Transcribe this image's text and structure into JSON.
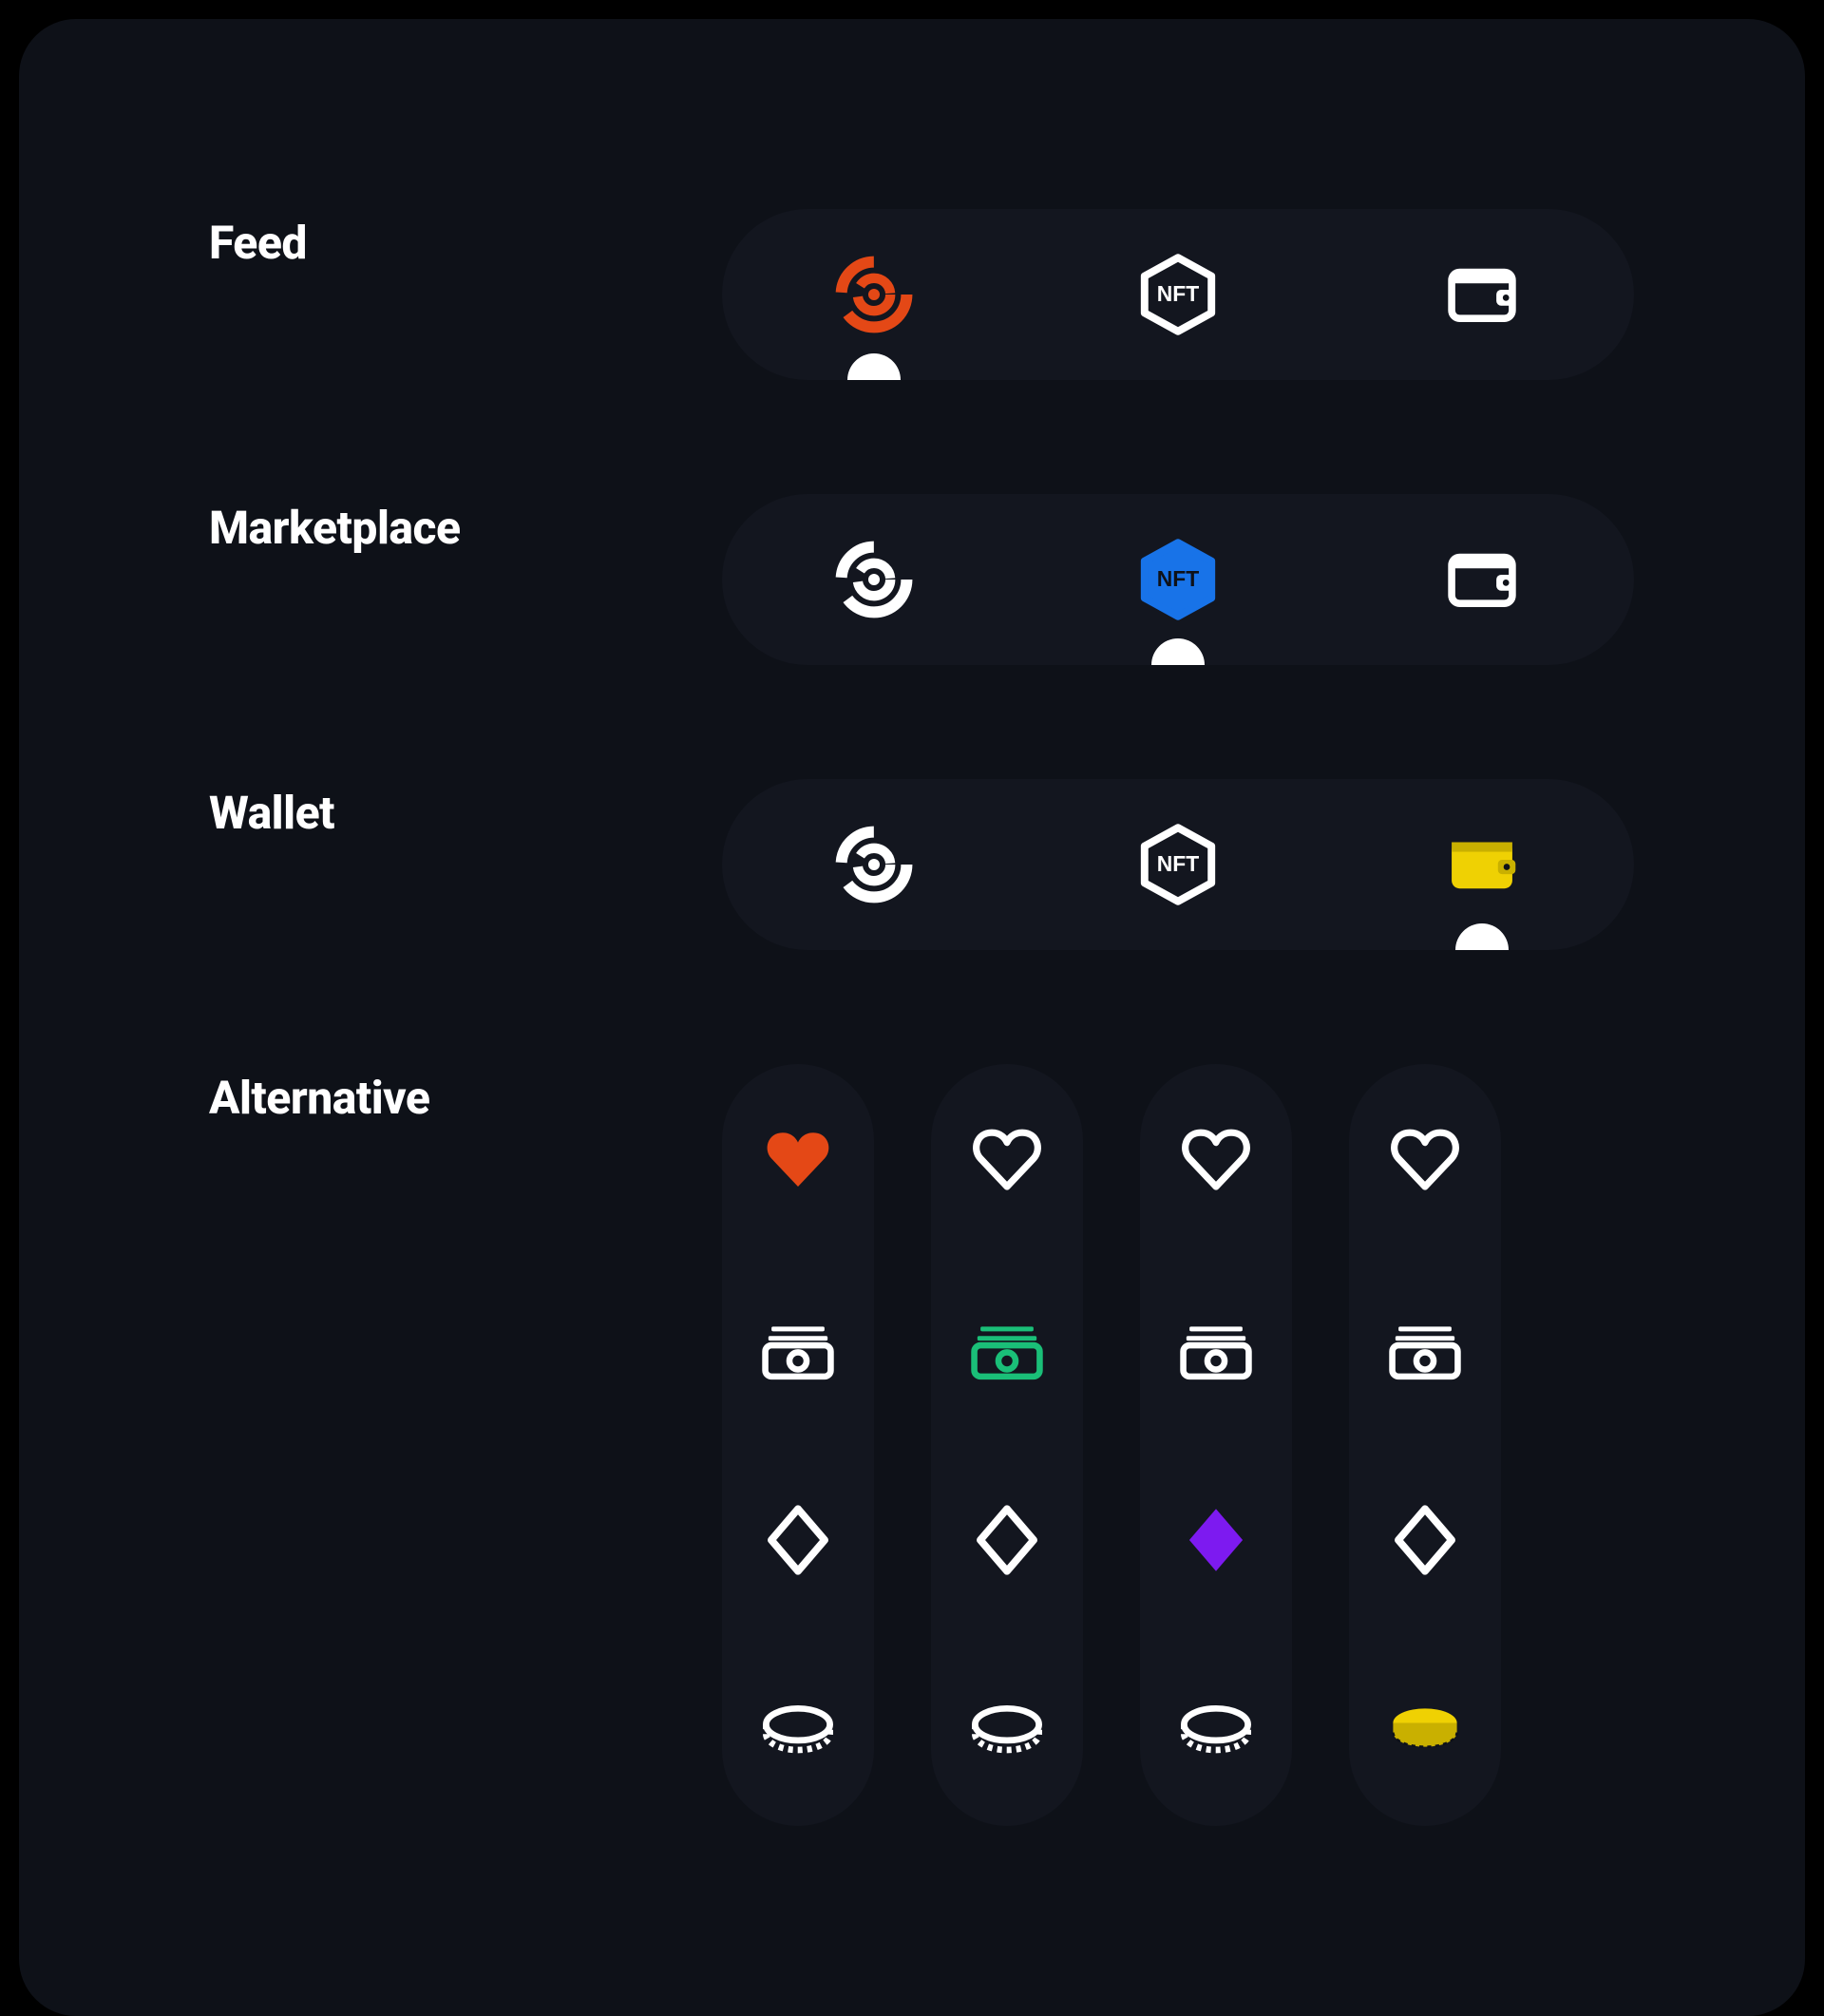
{
  "colors": {
    "orange": "#e44816",
    "blue": "#1873e8",
    "yellow": "#efd103",
    "green": "#1abf78",
    "purple": "#7d1af0",
    "white": "#ffffff",
    "panel": "#0e1118",
    "pill": "#13161f"
  },
  "nft_badge_text": "NFT",
  "rows": [
    {
      "key": "feed",
      "label": "Feed",
      "active_index": 0,
      "items": [
        {
          "icon": "feed",
          "active_color": "orange"
        },
        {
          "icon": "nft",
          "active_color": "blue"
        },
        {
          "icon": "wallet",
          "active_color": "yellow"
        }
      ]
    },
    {
      "key": "marketplace",
      "label": "Marketplace",
      "active_index": 1,
      "items": [
        {
          "icon": "feed",
          "active_color": "orange"
        },
        {
          "icon": "nft",
          "active_color": "blue"
        },
        {
          "icon": "wallet",
          "active_color": "yellow"
        }
      ]
    },
    {
      "key": "wallet",
      "label": "Wallet",
      "active_index": 2,
      "items": [
        {
          "icon": "feed",
          "active_color": "orange"
        },
        {
          "icon": "nft",
          "active_color": "blue"
        },
        {
          "icon": "wallet",
          "active_color": "yellow"
        }
      ]
    }
  ],
  "alternative": {
    "label": "Alternative",
    "columns": [
      {
        "active_index": 0,
        "items": [
          {
            "icon": "heart",
            "active_color": "orange"
          },
          {
            "icon": "cash",
            "active_color": "green"
          },
          {
            "icon": "diamond",
            "active_color": "purple"
          },
          {
            "icon": "coin",
            "active_color": "yellow"
          }
        ]
      },
      {
        "active_index": 1,
        "items": [
          {
            "icon": "heart",
            "active_color": "orange"
          },
          {
            "icon": "cash",
            "active_color": "green"
          },
          {
            "icon": "diamond",
            "active_color": "purple"
          },
          {
            "icon": "coin",
            "active_color": "yellow"
          }
        ]
      },
      {
        "active_index": 2,
        "items": [
          {
            "icon": "heart",
            "active_color": "orange"
          },
          {
            "icon": "cash",
            "active_color": "green"
          },
          {
            "icon": "diamond",
            "active_color": "purple"
          },
          {
            "icon": "coin",
            "active_color": "yellow"
          }
        ]
      },
      {
        "active_index": 3,
        "items": [
          {
            "icon": "heart",
            "active_color": "orange"
          },
          {
            "icon": "cash",
            "active_color": "green"
          },
          {
            "icon": "diamond",
            "active_color": "purple"
          },
          {
            "icon": "coin",
            "active_color": "yellow"
          }
        ]
      }
    ]
  }
}
